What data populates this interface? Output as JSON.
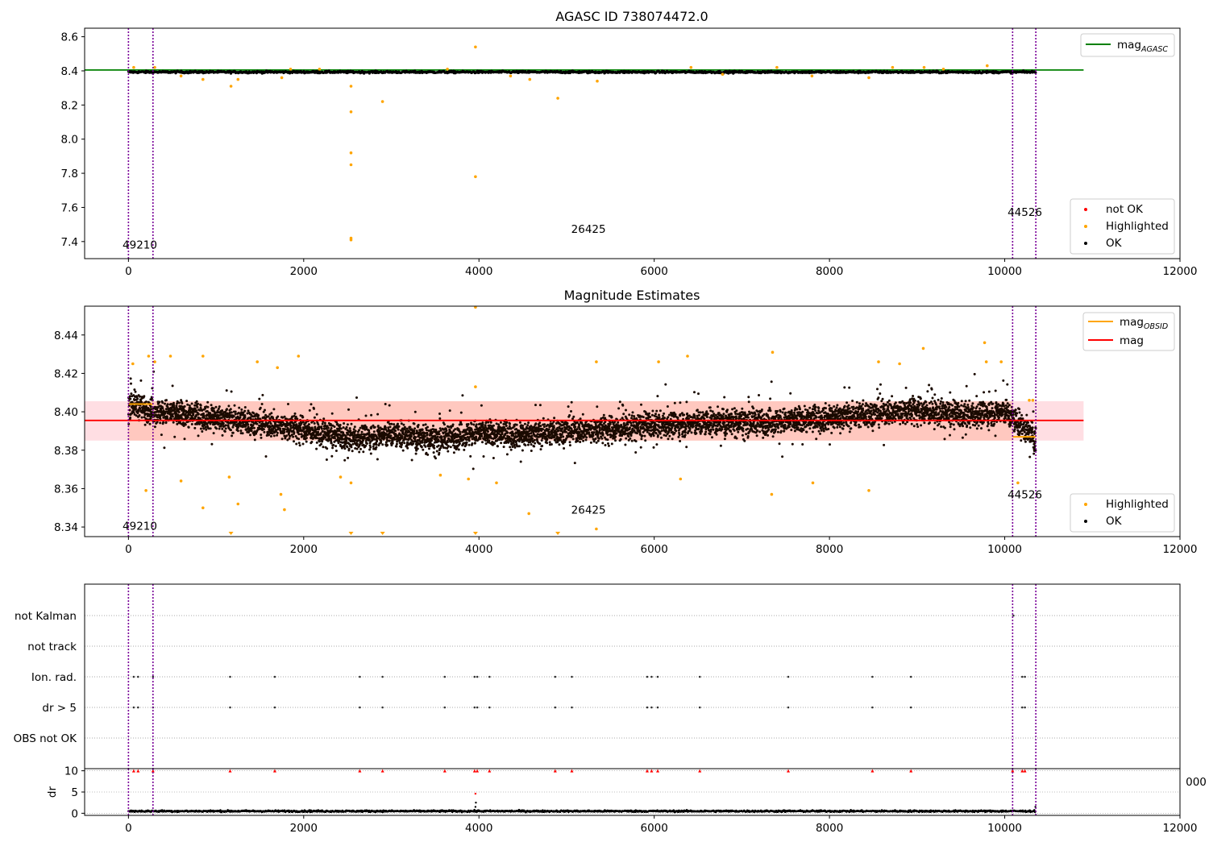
{
  "chart_data": [
    {
      "type": "scatter",
      "title": "AGASC ID 738074472.0",
      "xlim": [
        -500,
        12000
      ],
      "ylim": [
        7.3,
        8.65
      ],
      "xticks": [
        0,
        2000,
        4000,
        6000,
        8000,
        10000,
        12000
      ],
      "yticks": [
        7.4,
        7.6,
        7.8,
        8.0,
        8.2,
        8.4,
        8.6
      ],
      "ytick_labels": [
        "7.4",
        "7.6",
        "7.8",
        "8.0",
        "8.2",
        "8.4",
        "8.6"
      ],
      "obsid_boundaries": [
        0,
        280,
        10090,
        10355
      ],
      "obsid_labels": [
        {
          "text": "49210",
          "x": 130,
          "y": 7.36
        },
        {
          "text": "26425",
          "x": 5250,
          "y": 7.45
        },
        {
          "text": "44526",
          "x": 10230,
          "y": 7.55
        }
      ],
      "lines": [
        {
          "name": "mag_AGASC",
          "color": "#008000",
          "y": 8.405,
          "x_range": [
            -500,
            10900
          ]
        }
      ],
      "legend_upper": {
        "position": "upper right",
        "entries": [
          {
            "label": "mag",
            "subscript": "AGASC",
            "color": "#008000"
          }
        ]
      },
      "legend_lower": {
        "position": "lower right",
        "entries": [
          {
            "label": "not OK",
            "color": "#ff0000"
          },
          {
            "label": "Highlighted",
            "color": "#ffa500"
          },
          {
            "label": "OK",
            "color": "#000000"
          }
        ]
      },
      "series": [
        {
          "name": "OK",
          "color": "#000000",
          "band": [
            8.37,
            8.42
          ],
          "x_range": [
            0,
            10355
          ]
        },
        {
          "name": "Highlighted",
          "color": "#ffa500",
          "points": [
            [
              2540,
              8.31
            ],
            [
              2540,
              8.16
            ],
            [
              2540,
              7.92
            ],
            [
              2540,
              7.85
            ],
            [
              2540,
              7.42
            ],
            [
              2540,
              7.41
            ],
            [
              3960,
              8.54
            ],
            [
              3960,
              7.78
            ],
            [
              2900,
              8.22
            ],
            [
              4900,
              8.24
            ],
            [
              1170,
              8.31
            ],
            [
              1250,
              8.35
            ],
            [
              850,
              8.35
            ],
            [
              1750,
              8.36
            ],
            [
              600,
              8.37
            ],
            [
              5350,
              8.34
            ],
            [
              4580,
              8.35
            ],
            [
              8450,
              8.36
            ],
            [
              60,
              8.42
            ],
            [
              300,
              8.42
            ],
            [
              1850,
              8.41
            ],
            [
              7400,
              8.42
            ],
            [
              9800,
              8.43
            ],
            [
              6420,
              8.42
            ],
            [
              9080,
              8.42
            ],
            [
              2180,
              8.41
            ],
            [
              3640,
              8.41
            ],
            [
              4360,
              8.37
            ],
            [
              6780,
              8.38
            ],
            [
              7800,
              8.37
            ],
            [
              8720,
              8.42
            ],
            [
              9300,
              8.41
            ]
          ]
        }
      ]
    },
    {
      "type": "scatter",
      "title": "Magnitude Estimates",
      "xlim": [
        -500,
        12000
      ],
      "ylim": [
        8.335,
        8.455
      ],
      "xticks": [
        0,
        2000,
        4000,
        6000,
        8000,
        10000,
        12000
      ],
      "yticks": [
        8.34,
        8.36,
        8.38,
        8.4,
        8.42,
        8.44
      ],
      "ytick_labels": [
        "8.34",
        "8.36",
        "8.38",
        "8.40",
        "8.42",
        "8.44"
      ],
      "obsid_boundaries": [
        0,
        280,
        10090,
        10355
      ],
      "obsid_labels": [
        {
          "text": "49210",
          "x": 130,
          "y": 8.3385
        },
        {
          "text": "26425",
          "x": 5250,
          "y": 8.347
        },
        {
          "text": "44526",
          "x": 10230,
          "y": 8.355
        }
      ],
      "band": {
        "color": "#ff8c8c",
        "y_range": [
          8.385,
          8.4055
        ],
        "x_range": [
          -500,
          10900
        ],
        "fill_orange_range": [
          0,
          10090
        ]
      },
      "lines": [
        {
          "name": "mag",
          "color": "#ff0000",
          "y": 8.3955,
          "x_range": [
            -500,
            10900
          ]
        },
        {
          "name": "mag_OBSID",
          "color": "#ffa500",
          "segments": [
            [
              0,
              280,
              8.404
            ],
            [
              10090,
              10355,
              8.387
            ]
          ]
        }
      ],
      "legend_upper": {
        "position": "upper right",
        "entries": [
          {
            "label": "mag",
            "subscript": "OBSID",
            "color": "#ffa500"
          },
          {
            "label": "mag",
            "color": "#ff0000"
          }
        ]
      },
      "legend_lower": {
        "position": "lower right",
        "entries": [
          {
            "label": "Highlighted",
            "color": "#ffa500"
          },
          {
            "label": "OK",
            "color": "#000000"
          }
        ]
      },
      "series": [
        {
          "name": "OK",
          "color": "#000000",
          "trend": [
            [
              0,
              8.405
            ],
            [
              300,
              8.4
            ],
            [
              800,
              8.398
            ],
            [
              1500,
              8.394
            ],
            [
              2000,
              8.391
            ],
            [
              2500,
              8.386
            ],
            [
              3000,
              8.388
            ],
            [
              3500,
              8.386
            ],
            [
              4000,
              8.389
            ],
            [
              4500,
              8.388
            ],
            [
              5000,
              8.39
            ],
            [
              5500,
              8.391
            ],
            [
              6000,
              8.393
            ],
            [
              6500,
              8.394
            ],
            [
              7000,
              8.395
            ],
            [
              7500,
              8.395
            ],
            [
              8000,
              8.397
            ],
            [
              8500,
              8.399
            ],
            [
              9000,
              8.401
            ],
            [
              9500,
              8.398
            ],
            [
              10000,
              8.4
            ],
            [
              10355,
              8.386
            ]
          ],
          "spread": 0.012
        },
        {
          "name": "Highlighted",
          "color": "#ffa500",
          "points": [
            [
              3960,
              8.455
            ],
            [
              50,
              8.425
            ],
            [
              230,
              8.429
            ],
            [
              300,
              8.426
            ],
            [
              480,
              8.429
            ],
            [
              850,
              8.429
            ],
            [
              1470,
              8.426
            ],
            [
              1700,
              8.423
            ],
            [
              1940,
              8.429
            ],
            [
              3960,
              8.413
            ],
            [
              5340,
              8.426
            ],
            [
              6050,
              8.426
            ],
            [
              6380,
              8.429
            ],
            [
              7350,
              8.431
            ],
            [
              8560,
              8.426
            ],
            [
              8800,
              8.425
            ],
            [
              9070,
              8.433
            ],
            [
              9770,
              8.436
            ],
            [
              9790,
              8.426
            ],
            [
              9960,
              8.426
            ],
            [
              10280,
              8.406
            ],
            [
              10320,
              8.406
            ],
            [
              200,
              8.359
            ],
            [
              600,
              8.364
            ],
            [
              850,
              8.35
            ],
            [
              1150,
              8.366
            ],
            [
              1250,
              8.352
            ],
            [
              1740,
              8.357
            ],
            [
              1780,
              8.349
            ],
            [
              2420,
              8.366
            ],
            [
              2540,
              8.363
            ],
            [
              3560,
              8.367
            ],
            [
              3880,
              8.365
            ],
            [
              4200,
              8.363
            ],
            [
              4570,
              8.347
            ],
            [
              5340,
              8.339
            ],
            [
              6300,
              8.365
            ],
            [
              7340,
              8.357
            ],
            [
              7810,
              8.363
            ],
            [
              8450,
              8.359
            ],
            [
              10150,
              8.363
            ]
          ]
        },
        {
          "name": "Highlighted (below axis)",
          "color": "#ffa500",
          "marker": "triangle-down",
          "points": [
            [
              1170,
              8.3355
            ],
            [
              2540,
              8.3355
            ],
            [
              2900,
              8.3355
            ],
            [
              3960,
              8.3355
            ],
            [
              4900,
              8.3355
            ]
          ]
        }
      ]
    },
    {
      "type": "scatter",
      "title": "",
      "xlim": [
        -500,
        12000
      ],
      "flag_rows": [
        "not Kalman",
        "not track",
        "Ion. rad.",
        "dr > 5",
        "OBS not OK"
      ],
      "obsid_boundaries": [
        0,
        280,
        10090,
        10355
      ],
      "flag_points": {
        "not Kalman": [
          10100
        ],
        "not track": [],
        "Ion. rad.": [
          60,
          110,
          280,
          1160,
          1670,
          2640,
          2900,
          3610,
          3950,
          3980,
          4120,
          4870,
          5060,
          5920,
          5970,
          6040,
          6520,
          7530,
          8490,
          8930,
          10200,
          10230
        ],
        "dr > 5": [
          60,
          110,
          280,
          1160,
          1670,
          2640,
          2900,
          3610,
          3950,
          3980,
          4120,
          4870,
          5060,
          5920,
          5970,
          6040,
          6520,
          7530,
          8490,
          8930,
          10200,
          10230
        ],
        "OBS not OK": []
      }
    },
    {
      "type": "scatter",
      "title": "",
      "ylabel": "dr",
      "xlim": [
        -500,
        12000
      ],
      "ylim": [
        -0.5,
        10.5
      ],
      "xticks": [
        0,
        2000,
        4000,
        6000,
        8000,
        10000,
        12000
      ],
      "yticks": [
        0,
        5,
        10
      ],
      "ytick_labels": [
        "0",
        "5",
        "10"
      ],
      "cut_tick_label": "000",
      "obsid_boundaries": [
        0,
        280,
        10090,
        10355
      ],
      "series": [
        {
          "name": "OK",
          "color": "#000000",
          "band": [
            0.1,
            1.0
          ],
          "x_range": [
            0,
            10355
          ]
        },
        {
          "name": "clipped dr",
          "color": "#ff0000",
          "marker": "triangle-up",
          "y": 10,
          "x": [
            60,
            110,
            280,
            1160,
            1670,
            2640,
            2900,
            3610,
            3950,
            3980,
            4120,
            4870,
            5060,
            5920,
            5970,
            6040,
            6520,
            7530,
            8490,
            8930,
            10090,
            10200,
            10230
          ]
        },
        {
          "name": "outlier dr",
          "color": "#ff0000",
          "points": [
            [
              3960,
              4.6
            ]
          ]
        },
        {
          "name": "mid dr",
          "color": "#000000",
          "points": [
            [
              3960,
              1.5
            ],
            [
              3965,
              2.5
            ],
            [
              10350,
              1.5
            ]
          ]
        }
      ]
    }
  ]
}
